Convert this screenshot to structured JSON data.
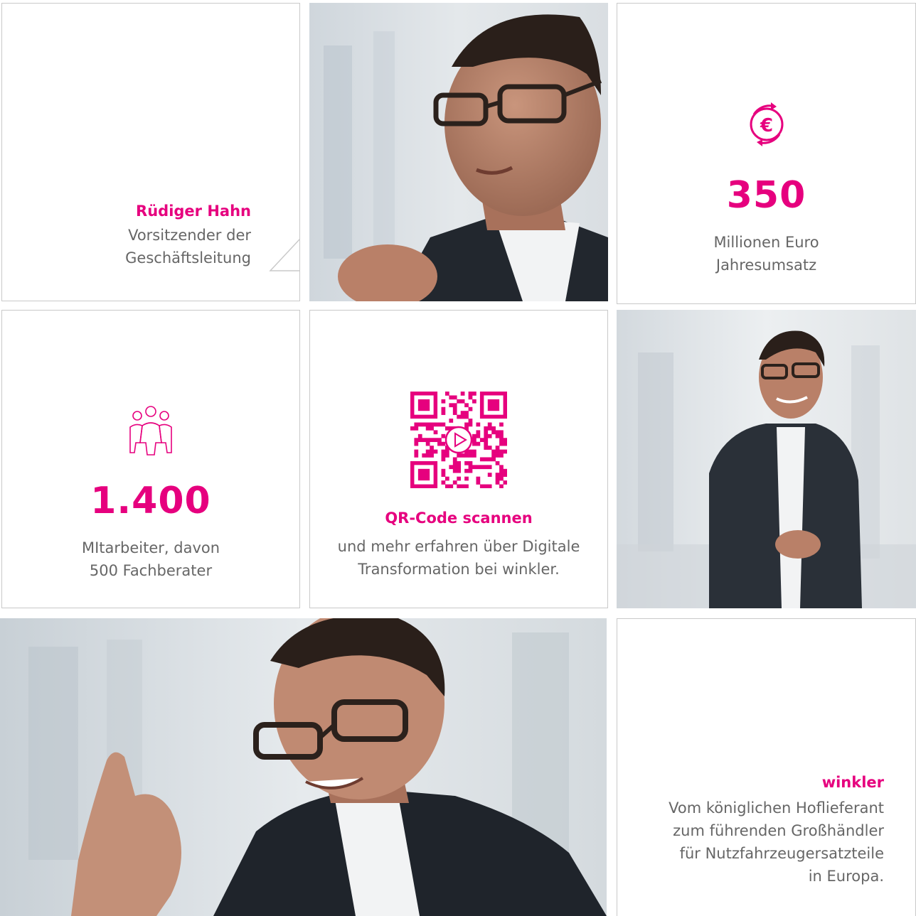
{
  "profile": {
    "name": "Rüdiger Hahn",
    "role_line1": "Vorsitzender der",
    "role_line2": "Geschäftsleitung"
  },
  "revenue": {
    "icon": "euro-cycle-icon",
    "value": "350",
    "label_line1": "Millionen Euro",
    "label_line2": "Jahresumsatz"
  },
  "employees": {
    "icon": "people-group-icon",
    "value": "1.400",
    "label_line1": "MItarbeiter, davon",
    "label_line2": "500 Fachberater"
  },
  "qr": {
    "icon": "qr-code-icon",
    "title": "QR-Code scannen",
    "text_line1": "und mehr erfahren über Digitale",
    "text_line2": "Transformation bei winkler."
  },
  "company": {
    "name": "winkler",
    "desc_line1": "Vom königlichen Hoflieferant",
    "desc_line2": "zum führenden Großhändler",
    "desc_line3": "für Nutzfahrzeugersatzteile",
    "desc_line4": "in Europa."
  },
  "colors": {
    "accent": "#e6007e",
    "text_gray": "#666666",
    "border": "#c9c9c9"
  }
}
